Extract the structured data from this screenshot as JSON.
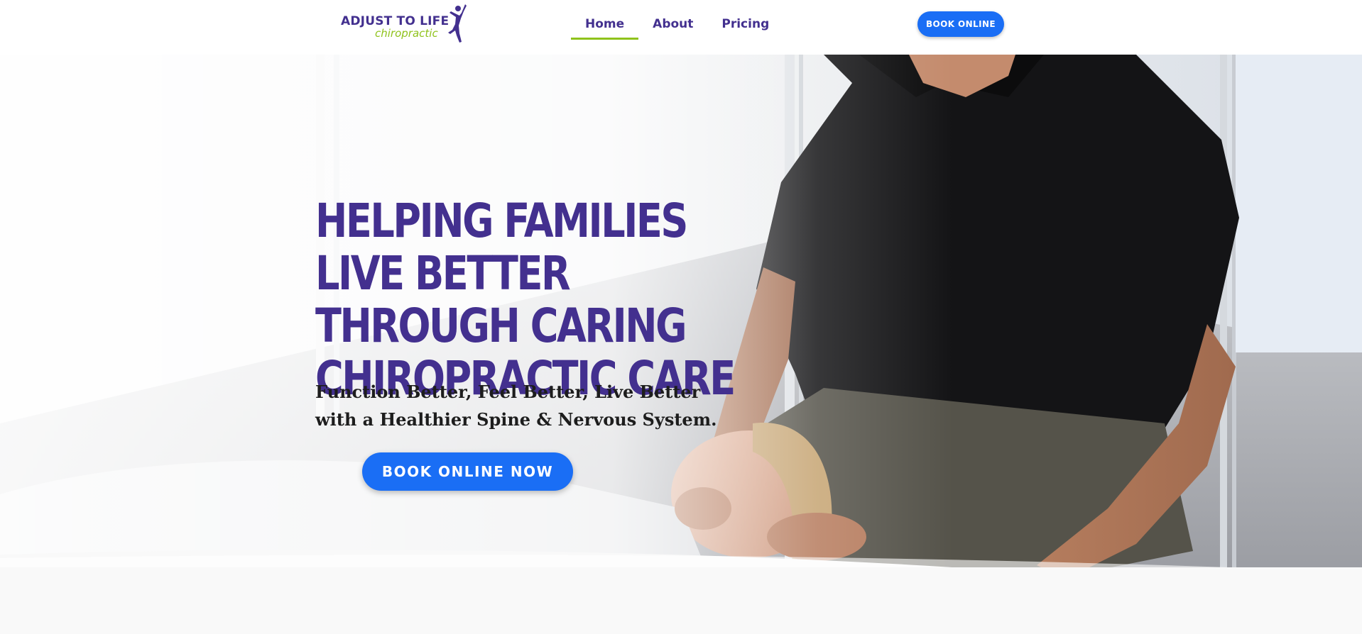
{
  "header": {
    "logo": {
      "line1": "ADJUST TO LIFE",
      "line2": "chiropractic"
    },
    "nav": [
      {
        "label": "Home",
        "active": true
      },
      {
        "label": "About",
        "active": false
      },
      {
        "label": "Pricing",
        "active": false
      }
    ],
    "book_button": "BOOK ONLINE"
  },
  "hero": {
    "headline_lines": [
      "HELPING FAMILIES",
      "LIVE BETTER",
      "THROUGH CARING",
      "CHIROPRACTIC CARE"
    ],
    "subhead_lines": [
      "Function Better, Feel Better, Live Better",
      "with a Healthier Spine & Nervous System."
    ],
    "cta_button": "BOOK ONLINE NOW"
  },
  "colors": {
    "brand_purple": "#43308f",
    "accent_green": "#8fc21b",
    "button_blue": "#1a6ef5"
  }
}
